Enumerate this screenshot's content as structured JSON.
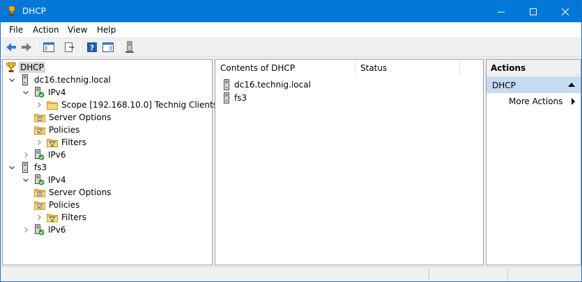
{
  "window": {
    "title": "DHCP",
    "app_icon": "dhcp-trophy-icon"
  },
  "menu": [
    "File",
    "Action",
    "View",
    "Help"
  ],
  "toolbar": [
    "back-arrow-icon",
    "forward-arrow-icon",
    "show-hide-console-tree-icon",
    "export-list-icon",
    "help-icon",
    "show-hide-action-pane-icon",
    "server-add-icon"
  ],
  "tree": [
    {
      "label": "DHCP",
      "icon": "dhcp-trophy-icon",
      "expander": "none",
      "selected": true
    },
    {
      "label": "dc16.technig.local",
      "icon": "server-icon",
      "expander": "expanded"
    },
    {
      "label": "IPv4",
      "icon": "server-ok-icon",
      "expander": "expanded"
    },
    {
      "label": "Scope [192.168.10.0] Technig Clients",
      "icon": "folder-icon",
      "expander": "collapsed"
    },
    {
      "label": "Server Options",
      "icon": "options-folder-icon",
      "expander": "none"
    },
    {
      "label": "Policies",
      "icon": "policies-folder-icon",
      "expander": "none"
    },
    {
      "label": "Filters",
      "icon": "filter-folder-icon",
      "expander": "collapsed"
    },
    {
      "label": "IPv6",
      "icon": "server-ok-icon",
      "expander": "collapsed"
    },
    {
      "label": "fs3",
      "icon": "server-icon",
      "expander": "expanded"
    },
    {
      "label": "IPv4",
      "icon": "server-ok-icon",
      "expander": "expanded"
    },
    {
      "label": "Server Options",
      "icon": "options-folder-icon",
      "expander": "none"
    },
    {
      "label": "Policies",
      "icon": "policies-folder-icon",
      "expander": "none"
    },
    {
      "label": "Filters",
      "icon": "filter-folder-icon",
      "expander": "collapsed"
    },
    {
      "label": "IPv6",
      "icon": "server-ok-icon",
      "expander": "collapsed"
    }
  ],
  "content": {
    "columns": [
      "Contents of DHCP",
      "Status"
    ],
    "rows": [
      {
        "name": "dc16.technig.local",
        "icon": "server-icon",
        "status": ""
      },
      {
        "name": "fs3",
        "icon": "server-icon",
        "status": ""
      }
    ]
  },
  "actions": {
    "header": "Actions",
    "section": "DHCP",
    "items": [
      "More Actions"
    ]
  }
}
